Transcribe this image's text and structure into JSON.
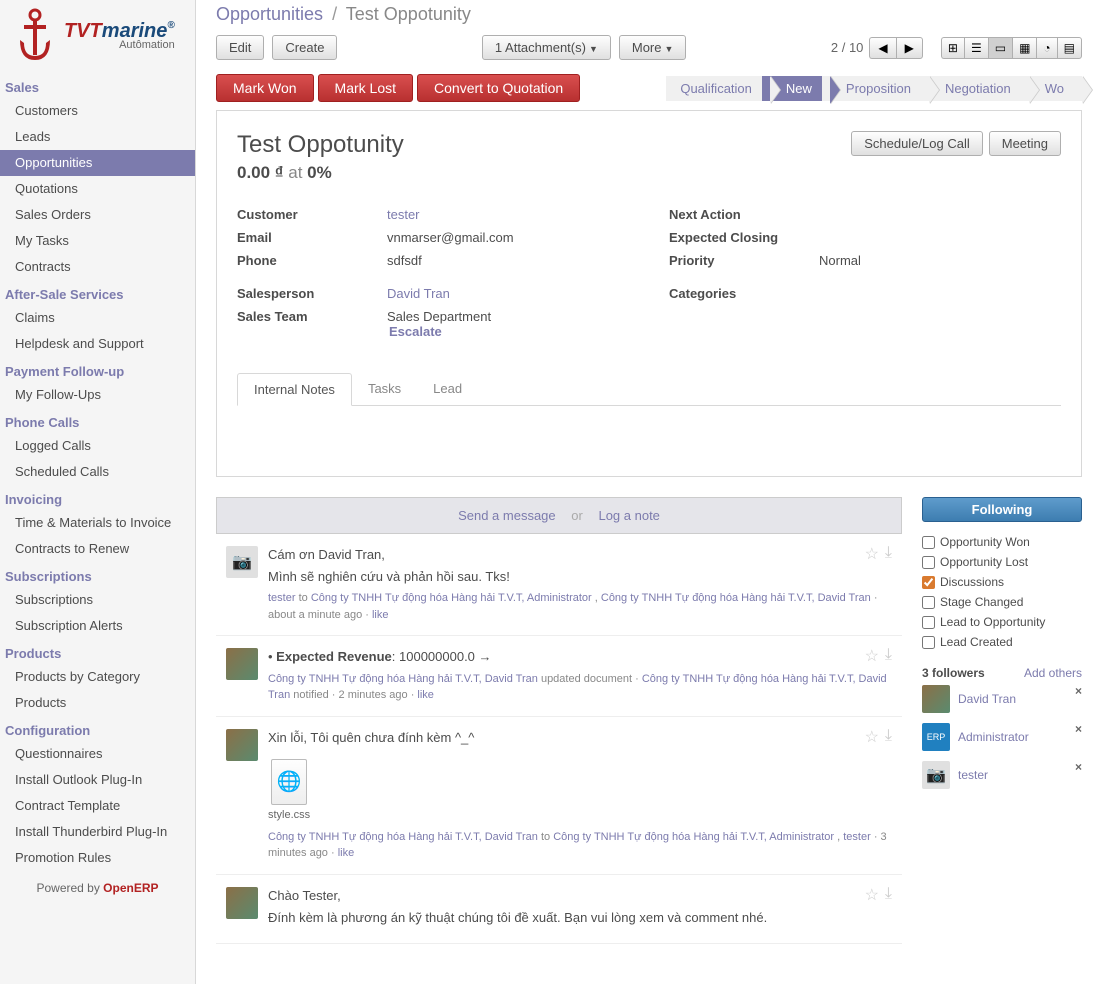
{
  "logo": {
    "brand_t": "TVT",
    "brand_m": "marine",
    "reg": "®",
    "sub": "Autômation"
  },
  "nav": [
    {
      "header": "Sales",
      "items": [
        {
          "label": "Customers"
        },
        {
          "label": "Leads"
        },
        {
          "label": "Opportunities",
          "active": true
        },
        {
          "label": "Quotations"
        },
        {
          "label": "Sales Orders"
        },
        {
          "label": "My Tasks"
        },
        {
          "label": "Contracts"
        }
      ]
    },
    {
      "header": "After-Sale Services",
      "items": [
        {
          "label": "Claims"
        },
        {
          "label": "Helpdesk and Support"
        }
      ]
    },
    {
      "header": "Payment Follow-up",
      "items": [
        {
          "label": "My Follow-Ups"
        }
      ]
    },
    {
      "header": "Phone Calls",
      "items": [
        {
          "label": "Logged Calls"
        },
        {
          "label": "Scheduled Calls"
        }
      ]
    },
    {
      "header": "Invoicing",
      "items": [
        {
          "label": "Time & Materials to Invoice"
        },
        {
          "label": "Contracts to Renew"
        }
      ]
    },
    {
      "header": "Subscriptions",
      "items": [
        {
          "label": "Subscriptions"
        },
        {
          "label": "Subscription Alerts"
        }
      ]
    },
    {
      "header": "Products",
      "items": [
        {
          "label": "Products by Category"
        },
        {
          "label": "Products"
        }
      ]
    },
    {
      "header": "Configuration",
      "items": [
        {
          "label": "Questionnaires"
        },
        {
          "label": "Install Outlook Plug-In"
        },
        {
          "label": "Contract Template"
        },
        {
          "label": "Install Thunderbird Plug-In"
        },
        {
          "label": "Promotion Rules"
        }
      ]
    }
  ],
  "powered": {
    "prefix": "Powered by ",
    "name": "OpenERP"
  },
  "breadcrumb": {
    "parent": "Opportunities",
    "current": "Test Oppotunity"
  },
  "toolbar": {
    "edit": "Edit",
    "create": "Create",
    "attachments": "1 Attachment(s)",
    "more": "More",
    "pager": "2 / 10"
  },
  "status": {
    "won": "Mark Won",
    "lost": "Mark Lost",
    "convert": "Convert to Quotation"
  },
  "stages": [
    {
      "label": "Qualification"
    },
    {
      "label": "New",
      "active": true
    },
    {
      "label": "Proposition"
    },
    {
      "label": "Negotiation"
    },
    {
      "label": "Wo"
    }
  ],
  "record": {
    "title": "Test Oppotunity",
    "amount": "0.00 ₫",
    "at": " at ",
    "prob": "0%",
    "schedule": "Schedule/Log Call",
    "meeting": "Meeting"
  },
  "fields_left": [
    {
      "label": "Customer",
      "value": "tester",
      "link": true
    },
    {
      "label": "Email",
      "value": "vnmarser@gmail.com"
    },
    {
      "label": "Phone",
      "value": "sdfsdf"
    }
  ],
  "fields_right": [
    {
      "label": "Next Action",
      "value": ""
    },
    {
      "label": "Expected Closing",
      "value": ""
    },
    {
      "label": "Priority",
      "value": "Normal"
    }
  ],
  "fields_left2": [
    {
      "label": "Salesperson",
      "value": "David Tran",
      "link": true
    },
    {
      "label": "Sales Team",
      "value": "Sales Department",
      "escalate": "Escalate"
    }
  ],
  "fields_right2": [
    {
      "label": "Categories",
      "value": ""
    }
  ],
  "tabs": [
    {
      "label": "Internal Notes",
      "active": true
    },
    {
      "label": "Tasks"
    },
    {
      "label": "Lead"
    }
  ],
  "compose": {
    "send": "Send a message",
    "or": "or",
    "log": "Log a note"
  },
  "messages": [
    {
      "avatar": "placeholder",
      "text": [
        "Cám ơn David Tran,",
        "Mình sẽ nghiên cứu và phản hồi sau. Tks!"
      ],
      "meta_html": "<a>tester</a> to <a>Công ty TNHH Tự động hóa Hàng hải T.V.T, Administrator</a> , <a>Công ty TNHH Tự động hóa Hàng hải T.V.T, David Tran</a> · <span class='time'>about a minute ago</span> · <a>like</a>"
    },
    {
      "avatar": "photo",
      "text": [
        "  • <b>Expected Revenue</b>: 100000000.0 →"
      ],
      "meta_html": "<a>Công ty TNHH Tự động hóa Hàng hải T.V.T, David Tran</a> updated document · <a>Công ty TNHH Tự động hóa Hàng hải T.V.T, David Tran</a> notified · <span class='time'>2 minutes ago</span> · <a>like</a>"
    },
    {
      "avatar": "photo",
      "text": [
        "Xin lỗi, Tôi quên chưa đính kèm ^_^"
      ],
      "attachment": {
        "name": "style.css"
      },
      "meta_html": "<a>Công ty TNHH Tự động hóa Hàng hải T.V.T, David Tran</a> to <a>Công ty TNHH Tự động hóa Hàng hải T.V.T, Administrator</a> , <a>tester</a> · <span class='time'>3 minutes ago</span> · <a>like</a>"
    },
    {
      "avatar": "photo",
      "text": [
        "Chào Tester,",
        "Đính kèm là phương án kỹ thuật chúng tôi đề xuất. Bạn vui lòng xem và comment nhé."
      ]
    }
  ],
  "follow": {
    "button": "Following",
    "subs": [
      {
        "label": "Opportunity Won",
        "checked": false
      },
      {
        "label": "Opportunity Lost",
        "checked": false
      },
      {
        "label": "Discussions",
        "checked": true
      },
      {
        "label": "Stage Changed",
        "checked": false
      },
      {
        "label": "Lead to Opportunity",
        "checked": false
      },
      {
        "label": "Lead Created",
        "checked": false
      }
    ],
    "count": "3 followers",
    "add": "Add others",
    "followers": [
      {
        "name": "David Tran",
        "avatar": "photo"
      },
      {
        "name": "Administrator",
        "avatar": "erp"
      },
      {
        "name": "tester",
        "avatar": "placeholder"
      }
    ]
  }
}
